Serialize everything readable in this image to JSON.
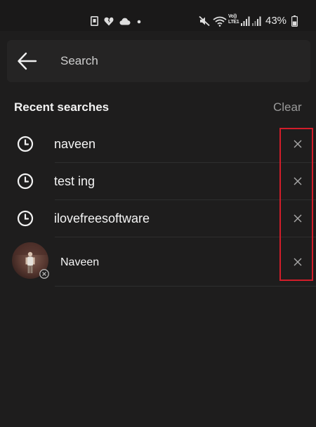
{
  "status_bar": {
    "battery": "43%",
    "volte": "Vo)) LTE1"
  },
  "search": {
    "placeholder": "Search",
    "value": ""
  },
  "recent": {
    "title": "Recent searches",
    "clear_label": "Clear",
    "items": [
      {
        "label": "naveen",
        "type": "query",
        "icon": "clock-icon"
      },
      {
        "label": "test ing",
        "type": "query",
        "icon": "clock-icon"
      },
      {
        "label": "ilovefreesoftware",
        "type": "query",
        "icon": "clock-icon"
      },
      {
        "label": "Naveen",
        "type": "profile",
        "icon": "avatar"
      }
    ]
  },
  "colors": {
    "background": "#1e1d1d",
    "search_bg": "#252424",
    "highlight": "#d21d2a",
    "muted_text": "#9a9a9a"
  }
}
